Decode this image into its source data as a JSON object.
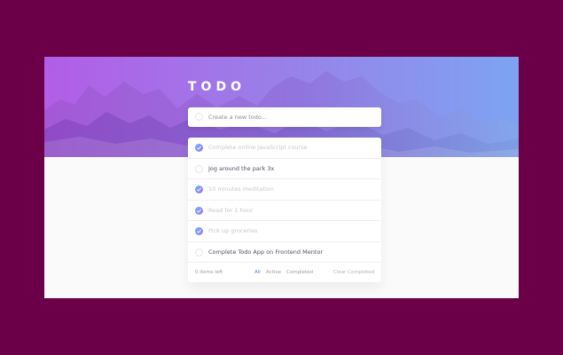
{
  "header": {
    "title": "TODO"
  },
  "new_todo": {
    "placeholder": "Create a new todo..."
  },
  "todos": [
    {
      "text": "Complete online JavaScript course",
      "completed": true
    },
    {
      "text": "Jog around the park 3x",
      "completed": false
    },
    {
      "text": "10 minutes meditation",
      "completed": true
    },
    {
      "text": "Read for 1 hour",
      "completed": true
    },
    {
      "text": "Pick up groceries",
      "completed": true
    },
    {
      "text": "Complete Todo App on Frontend Mentor",
      "completed": false
    }
  ],
  "footer": {
    "items_left": "0 items left",
    "filters": [
      "All",
      "Active",
      "Completed"
    ],
    "active_filter": "All",
    "clear_completed": "Clear Completed"
  },
  "colors": {
    "page_background": "#6b0049",
    "hero_gradient_start": "#b25ce6",
    "hero_gradient_end": "#7ea2f2",
    "check_gradient_start": "#62b7ff",
    "check_gradient_end": "#a76dff",
    "active_filter": "#4d7cff"
  },
  "icons": {
    "theme_toggle": "moon-icon",
    "checked": "check-icon"
  }
}
